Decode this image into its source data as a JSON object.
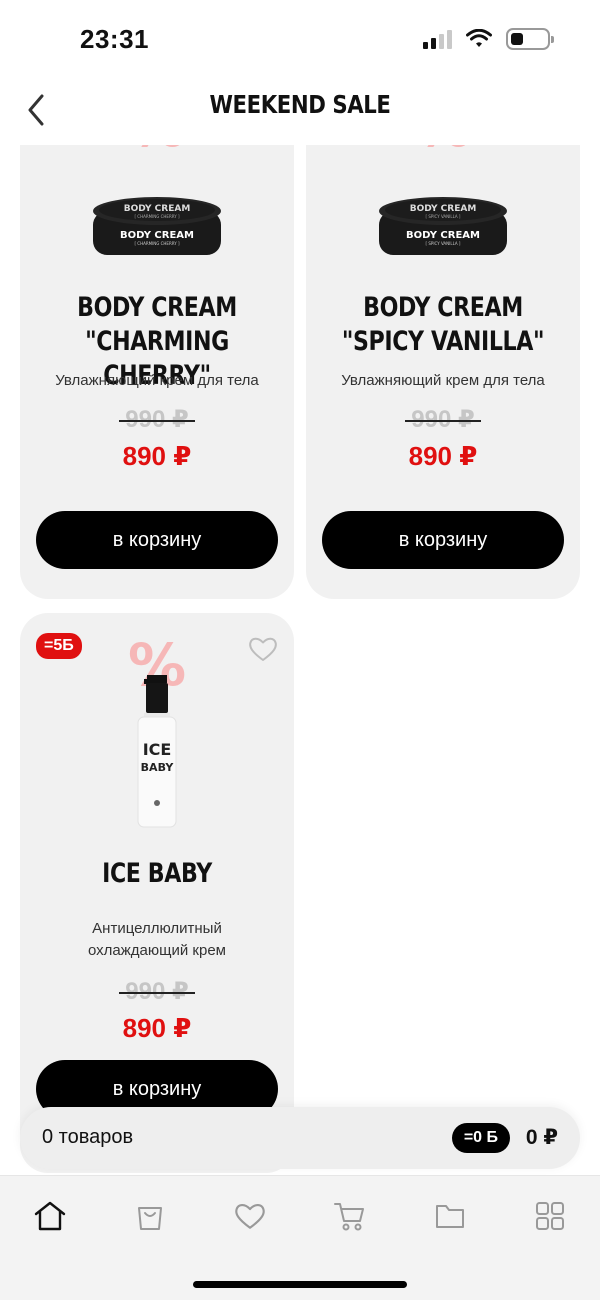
{
  "status_bar": {
    "time": "23:31"
  },
  "header": {
    "title": "WEEKEND SALE"
  },
  "products": [
    {
      "name_line1": "BODY CREAM",
      "name_line2": "\"CHARMING CHERRY\"",
      "label_big": "BODY CREAM",
      "label_small": "[ CHARMING CHERRY ]",
      "lid_text": "BODY CREAM",
      "lid_subtext": "[ CHARMING CHERRY ]",
      "description": "Увлажняющий крем для тела",
      "old_price": "990 ₽",
      "new_price": "890 ₽",
      "button_label": "в корзину"
    },
    {
      "name_line1": "BODY CREAM",
      "name_line2": "\"SPICY VANILLA\"",
      "label_big": "BODY CREAM",
      "label_small": "[ SPICY VANILLA ]",
      "lid_text": "BODY CREAM",
      "lid_subtext": "[ SPICY VANILLA ]",
      "description": "Увлажняющий крем для тела",
      "old_price": "990 ₽",
      "new_price": "890 ₽",
      "button_label": "в корзину"
    },
    {
      "name_line1": "ICE BABY",
      "bottle_text_1": "ICE",
      "bottle_text_2": "BABY",
      "badge": "=5Б",
      "description_line1": "Антицеллюлитный",
      "description_line2": "охлаждающий крем",
      "old_price": "990 ₽",
      "new_price": "890 ₽",
      "button_label": "в корзину"
    }
  ],
  "cart_summary": {
    "count_label": "0 товаров",
    "points": "=0 Б",
    "total": "0 ₽"
  },
  "decor": {
    "percent_symbol": "%"
  },
  "colors": {
    "accent": "#e01010",
    "card_bg": "#f1f1f1",
    "button_bg": "#000000"
  },
  "tab_bar": {
    "icons": [
      "home-icon",
      "bag-icon",
      "heart-icon",
      "cart-icon",
      "folder-icon",
      "grid-icon"
    ],
    "active": "home-icon"
  }
}
